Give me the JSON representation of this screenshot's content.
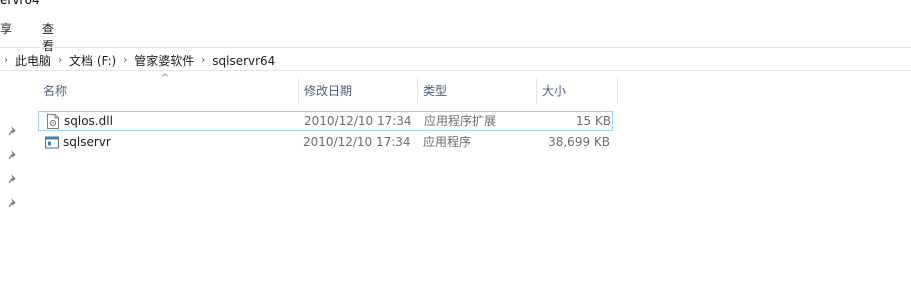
{
  "window": {
    "title": "ervr64"
  },
  "ribbon": {
    "tabs": [
      "享",
      "查看"
    ]
  },
  "breadcrumb": {
    "items": [
      "此电脑",
      "文档 (F:)",
      "管家婆软件",
      "sqlservr64"
    ]
  },
  "columns": {
    "name": "名称",
    "date": "修改日期",
    "type": "类型",
    "size": "大小"
  },
  "files": [
    {
      "name": "sqlos.dll",
      "date": "2010/12/10 17:34",
      "type": "应用程序扩展",
      "size": "15 KB",
      "icon": "dll-file-icon"
    },
    {
      "name": "sqlservr",
      "date": "2010/12/10 17:34",
      "type": "应用程序",
      "size": "38,699 KB",
      "icon": "exe-file-icon"
    }
  ],
  "quick_access_pins": 4,
  "colors": {
    "selection_border": "#99d1ff",
    "header_text": "#4c607a"
  }
}
